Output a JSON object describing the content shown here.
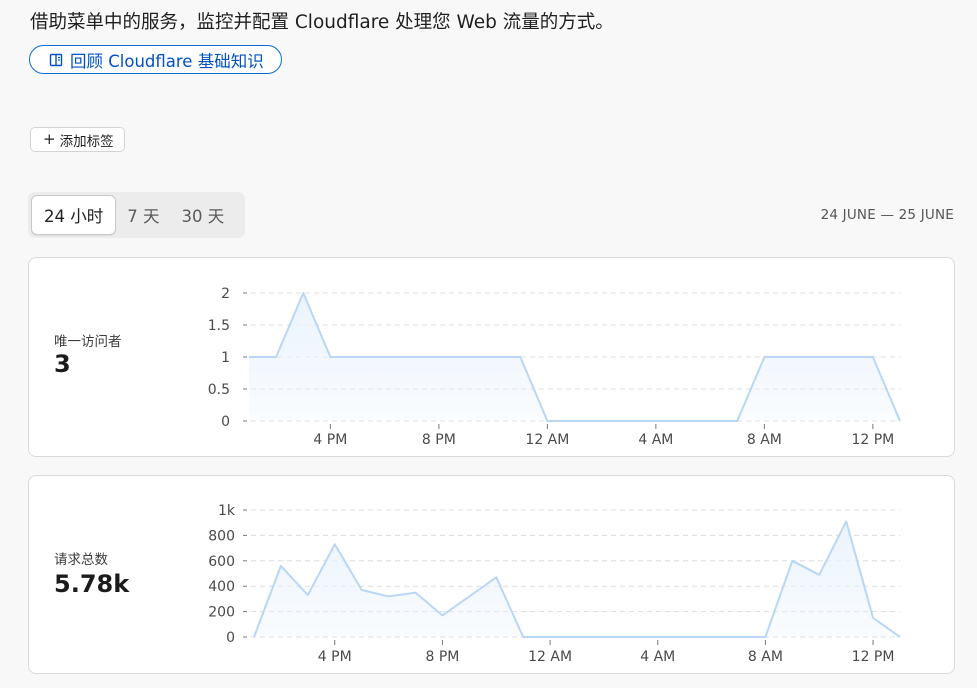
{
  "header": {
    "description": "借助菜单中的服务，监控并配置 Cloudflare 处理您 Web 流量的方式。",
    "kb_link_label": "回顾 Cloudflare 基础知识",
    "kb_link_icon": "book-icon"
  },
  "tags": {
    "add_label": "添加标签",
    "add_icon": "plus-icon"
  },
  "time_range": {
    "options": [
      "24 小时",
      "7 天",
      "30 天"
    ],
    "selected": "24 小时",
    "date_range": "24 JUNE — 25 JUNE"
  },
  "colors": {
    "accent": "#0b6cd8",
    "chart_line": "#b9d7f5",
    "chart_fill": "#eaf3fd"
  },
  "cards": [
    {
      "label": "唯一访问者",
      "value": "3"
    },
    {
      "label": "请求总数",
      "value": "5.78k"
    }
  ],
  "chart_data": [
    {
      "type": "area",
      "x_tick_labels": [
        "4 PM",
        "8 PM",
        "12 AM",
        "4 AM",
        "8 AM",
        "12 PM"
      ],
      "x": [
        "1 PM",
        "2 PM",
        "3 PM",
        "4 PM",
        "5 PM",
        "6 PM",
        "7 PM",
        "8 PM",
        "9 PM",
        "10 PM",
        "11 PM",
        "12 AM",
        "1 AM",
        "2 AM",
        "3 AM",
        "4 AM",
        "5 AM",
        "6 AM",
        "7 AM",
        "8 AM",
        "9 AM",
        "10 AM",
        "11 AM",
        "12 PM",
        "1 PM"
      ],
      "series": [
        {
          "values": [
            1,
            1,
            2,
            1,
            1,
            1,
            1,
            1,
            1,
            1,
            1,
            0,
            0,
            0,
            0,
            0,
            0,
            0,
            0,
            1,
            1,
            1,
            1,
            1,
            0
          ]
        }
      ],
      "y_tick_labels": [
        "0",
        "0.5",
        "1",
        "1.5",
        "2"
      ],
      "y_ticks": [
        0,
        0.5,
        1,
        1.5,
        2
      ],
      "ylim": [
        0,
        2
      ],
      "grid": true
    },
    {
      "type": "area",
      "x_tick_labels": [
        "4 PM",
        "8 PM",
        "12 AM",
        "4 AM",
        "8 AM",
        "12 PM"
      ],
      "x": [
        "1 PM",
        "2 PM",
        "3 PM",
        "4 PM",
        "5 PM",
        "6 PM",
        "7 PM",
        "8 PM",
        "9 PM",
        "10 PM",
        "11 PM",
        "12 AM",
        "1 AM",
        "2 AM",
        "3 AM",
        "4 AM",
        "5 AM",
        "6 AM",
        "7 AM",
        "8 AM",
        "9 AM",
        "10 AM",
        "11 AM",
        "12 PM",
        "1 PM"
      ],
      "series": [
        {
          "values": [
            0,
            560,
            330,
            730,
            370,
            320,
            350,
            170,
            320,
            470,
            0,
            0,
            0,
            0,
            0,
            0,
            0,
            0,
            0,
            0,
            600,
            490,
            910,
            150,
            0
          ]
        }
      ],
      "y_tick_labels": [
        "0",
        "200",
        "400",
        "600",
        "800",
        "1k"
      ],
      "y_ticks": [
        0,
        200,
        400,
        600,
        800,
        1000
      ],
      "ylim": [
        0,
        1000
      ],
      "grid": true
    }
  ]
}
